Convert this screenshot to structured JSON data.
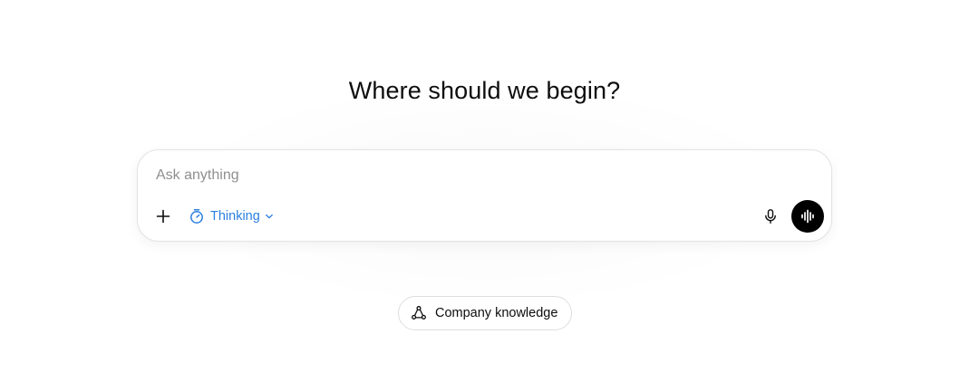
{
  "headline": "Where should we begin?",
  "composer": {
    "placeholder": "Ask anything",
    "value": "",
    "model_mode_label": "Thinking",
    "icons": {
      "attach": "plus-icon",
      "mode": "timer-icon",
      "mode_dropdown": "chevron-down-icon",
      "dictate": "microphone-icon",
      "voice": "voice-waveform-icon"
    }
  },
  "chips": [
    {
      "label": "Company knowledge",
      "icon": "connectors-icon"
    }
  ],
  "colors": {
    "accent": "#2b7fe0",
    "text": "#0d0d0d",
    "placeholder": "#8f8f8f",
    "voice_button": "#000000"
  }
}
